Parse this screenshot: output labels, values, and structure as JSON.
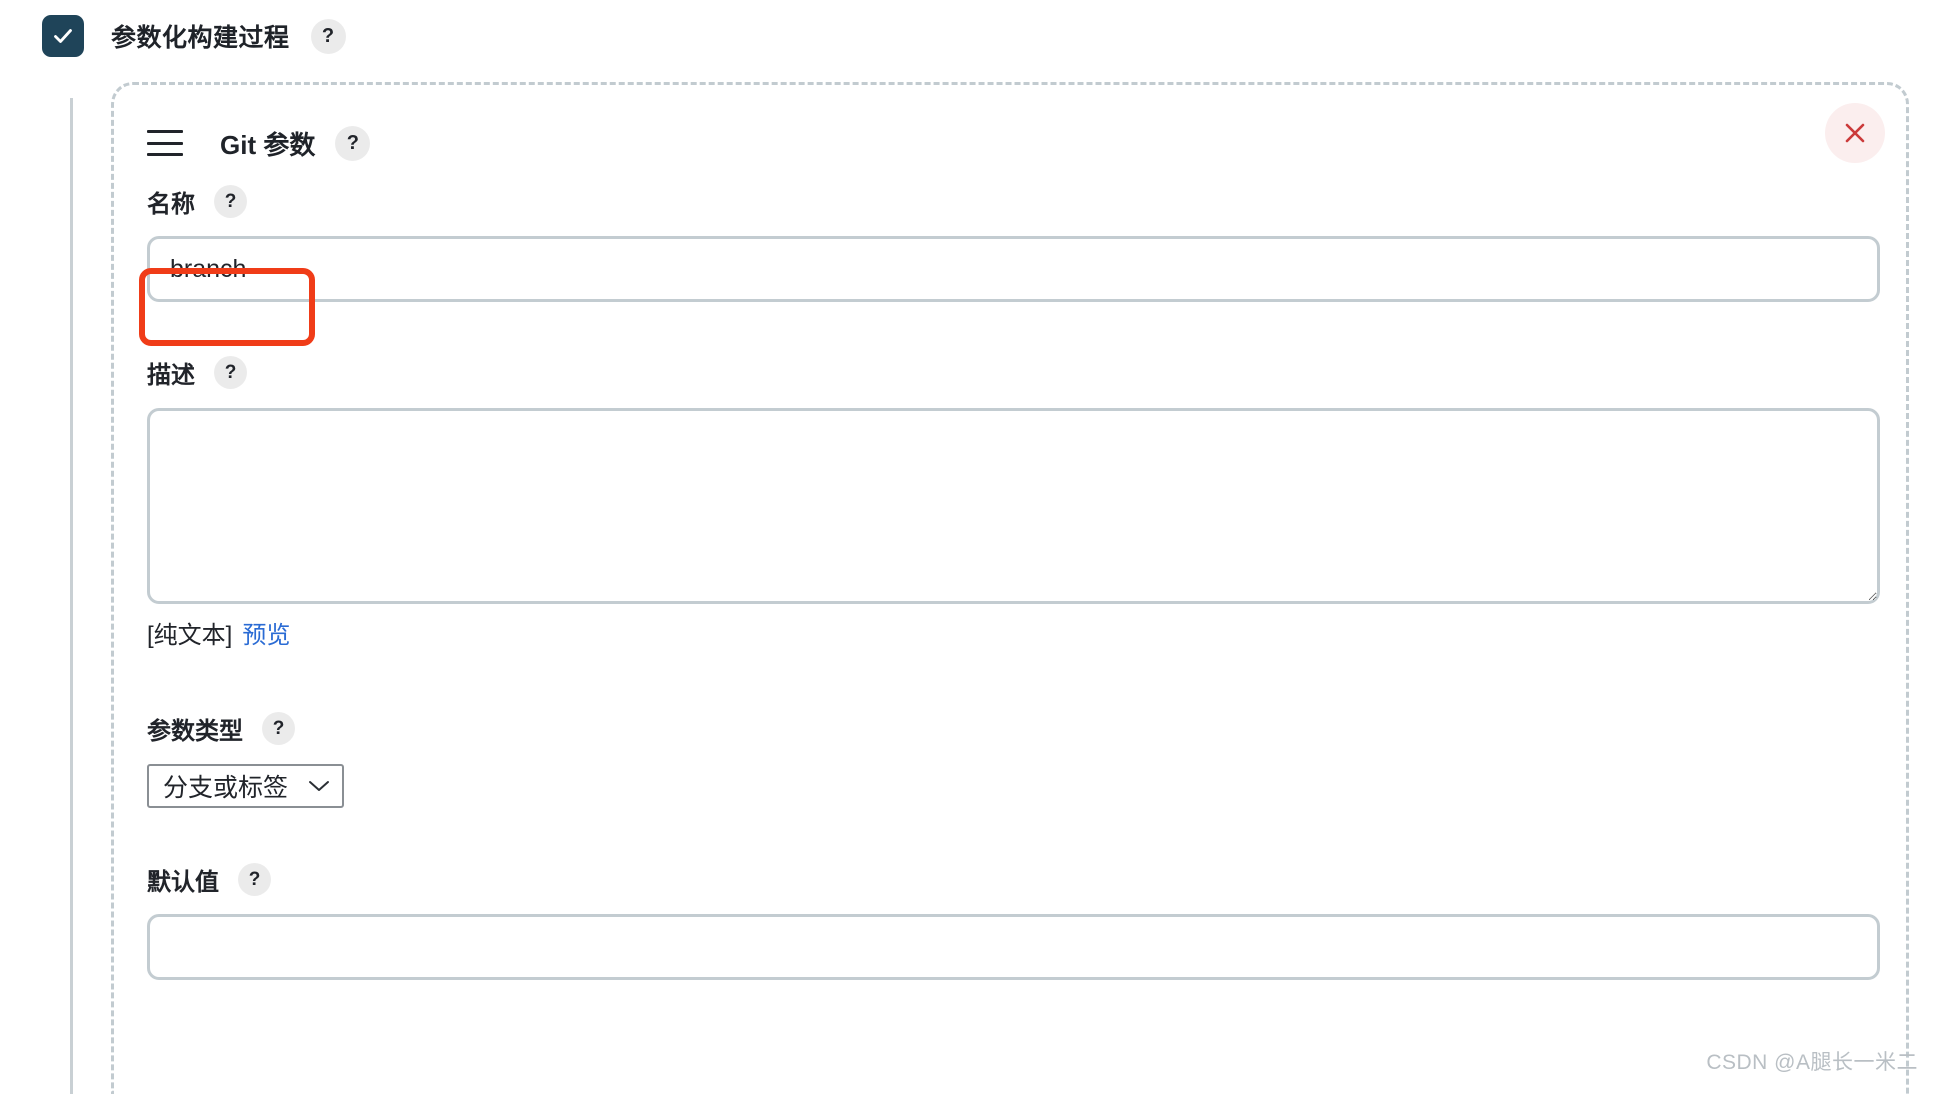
{
  "page": {
    "parameterized_build": {
      "label": "参数化构建过程",
      "checked": true,
      "help_glyph": "?"
    }
  },
  "panel": {
    "title": "Git 参数",
    "help_glyph": "?",
    "menu_icon": "hamburger-menu-icon",
    "close_icon": "close-icon",
    "close_color": "#cb3a3a",
    "close_bg": "#fbeeee"
  },
  "fields": {
    "name": {
      "label": "名称",
      "help_glyph": "?",
      "value": "branch",
      "placeholder": ""
    },
    "description": {
      "label": "描述",
      "help_glyph": "?",
      "value": "",
      "placeholder": "",
      "format_note": "[纯文本]",
      "preview_link": "预览"
    },
    "param_type": {
      "label": "参数类型",
      "help_glyph": "?",
      "selected": "分支或标签",
      "options": [
        "分支或标签"
      ],
      "chevron_icon": "chevron-down-icon"
    },
    "default_value": {
      "label": "默认值",
      "help_glyph": "?",
      "value": "",
      "placeholder": ""
    }
  },
  "annotation": {
    "color": "#f03c18",
    "target": "name-input"
  },
  "watermark": {
    "text": "CSDN @A腿长一米二"
  },
  "colors": {
    "checkbox_bg": "#1f4459",
    "input_border": "#c3ccd1",
    "panel_border": "#c2cbd0",
    "link": "#2a6bd4",
    "help_badge_bg": "#ebebeb"
  }
}
